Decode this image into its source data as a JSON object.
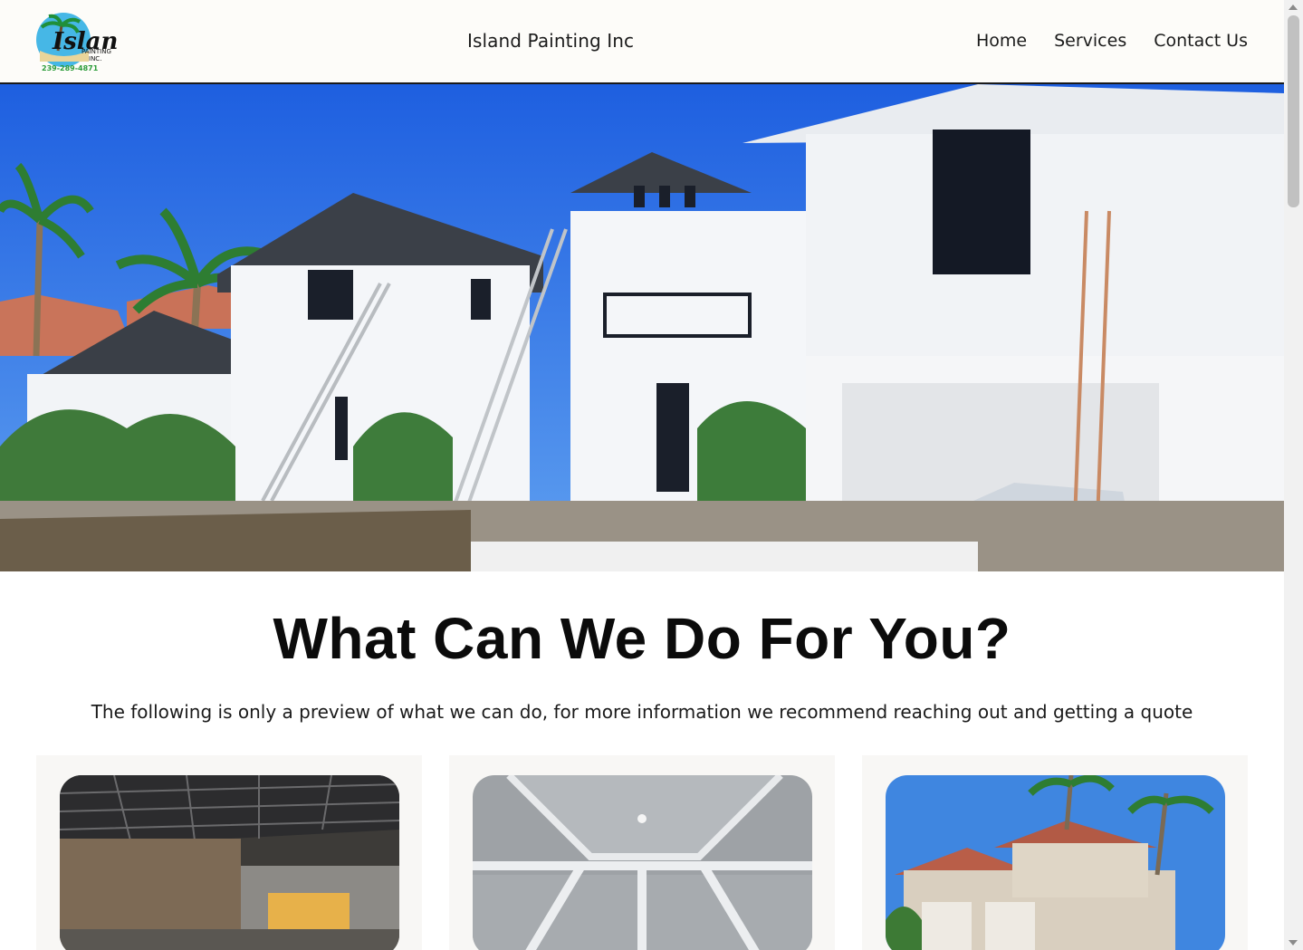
{
  "header": {
    "brand": "Island Painting Inc",
    "logo": {
      "word": "Island",
      "sub1": "PAINTING",
      "sub2": "INC.",
      "phone": "239-289-4871"
    },
    "nav": [
      {
        "label": "Home"
      },
      {
        "label": "Services"
      },
      {
        "label": "Contact Us"
      }
    ]
  },
  "main": {
    "title": "What Can We Do For You?",
    "subtitle": "The following is only a preview of what we can do, for more information we recommend reaching out and getting a quote"
  },
  "colors": {
    "header_bg": "#fdfcf9",
    "card_bg": "#f8f7f5",
    "sky": "#2f73e8"
  }
}
